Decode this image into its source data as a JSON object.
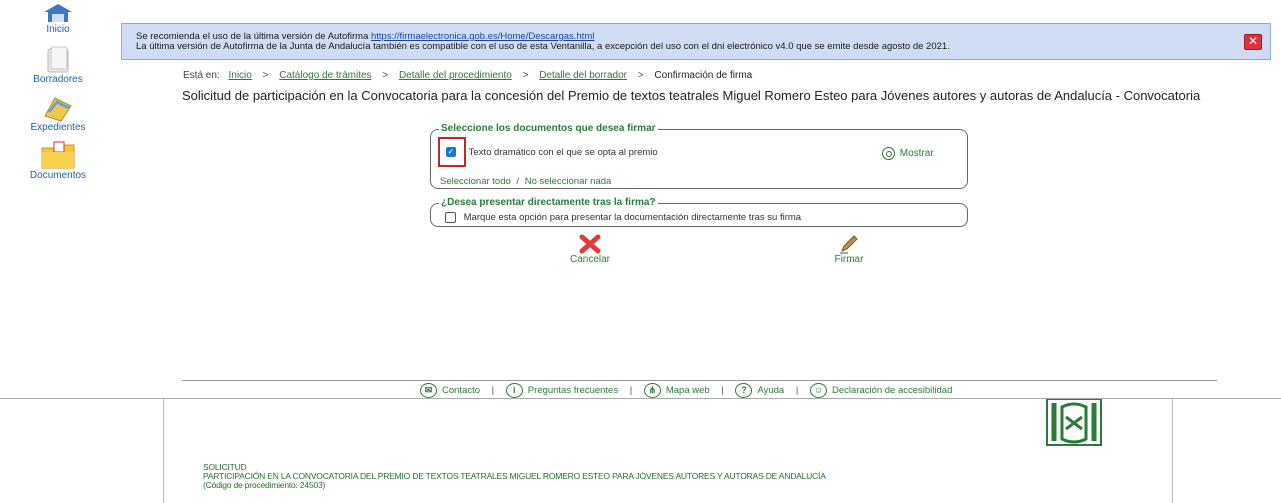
{
  "sidebar": {
    "items": [
      {
        "label": "Inicio",
        "icon": "home-icon"
      },
      {
        "label": "Borradores",
        "icon": "drafts-icon"
      },
      {
        "label": "Expedientes",
        "icon": "files-icon"
      },
      {
        "label": "Documentos",
        "icon": "documents-folder-icon"
      }
    ]
  },
  "banner": {
    "line1_prefix": "Se recomienda el uso de la última versión de Autofirma",
    "line1_link": "https://firmaelectronica.gob.es/Home/Descargas.html",
    "line2": "La última versión de Autofirma de la Junta de Andalucía también es compatible con el uso de esta Ventanilla, a excepción del uso con el dni electrónico v4.0 que se emite desde agosto de 2021.",
    "close_icon": "close-icon",
    "close_color": "#e0323a"
  },
  "breadcrumb": {
    "prefix": "Está en:",
    "items": [
      "Inicio",
      "Catálogo de trámites",
      "Detalle del procedimiento",
      "Detalle del borrador"
    ],
    "separator": ">",
    "current": "Confirmación de firma"
  },
  "page_title": "Solicitud de participación en la Convocatoria para la concesión del Premio de textos teatrales Miguel Romero Esteo para Jóvenes autores y autoras de Andalucía - Convocatoria",
  "sign_docs": {
    "legend": "Seleccione los documentos que desea firmar",
    "document_label": "Texto dramático con el que se opta al premio",
    "document_checked": true,
    "show_label": "Mostrar",
    "select_all": "Seleccionar todo",
    "select_sep": "/",
    "select_none": "No seleccionar nada"
  },
  "submit_option": {
    "legend": "¿Desea presentar directamente tras la firma?",
    "label": "Marque esta opción para presentar la documentación directamente tras su firma",
    "checked": false
  },
  "actions": {
    "cancel_label": "Cancelar",
    "sign_label": "Firmar"
  },
  "footer": {
    "separator": "|",
    "links": [
      {
        "label": "Contacto",
        "icon": "mail-icon"
      },
      {
        "label": "Preguntas frecuentes",
        "icon": "info-icon"
      },
      {
        "label": "Mapa web",
        "icon": "sitemap-icon"
      },
      {
        "label": "Ayuda",
        "icon": "help-icon"
      },
      {
        "label": "Declaración de accesibilidad",
        "icon": "accessibility-icon"
      }
    ]
  },
  "doc_preview": {
    "line1": "SOLICITUD",
    "line2": "PARTICIPACIÓN EN LA CONVOCATORIA DEL PREMIO DE TEXTOS TEATRALES MIGUEL ROMERO ESTEO PARA JÓVENES AUTORES Y AUTORAS DE ANDALUCÍA",
    "line3": "(Código de procedimiento: 24503)",
    "logo": "junta-andalucia-logo"
  },
  "colors": {
    "accent_green": "#2e7a3c",
    "banner_bg": "#cfdcf4",
    "link_blue": "#1f5f9f",
    "highlight_red": "#c0282d"
  }
}
